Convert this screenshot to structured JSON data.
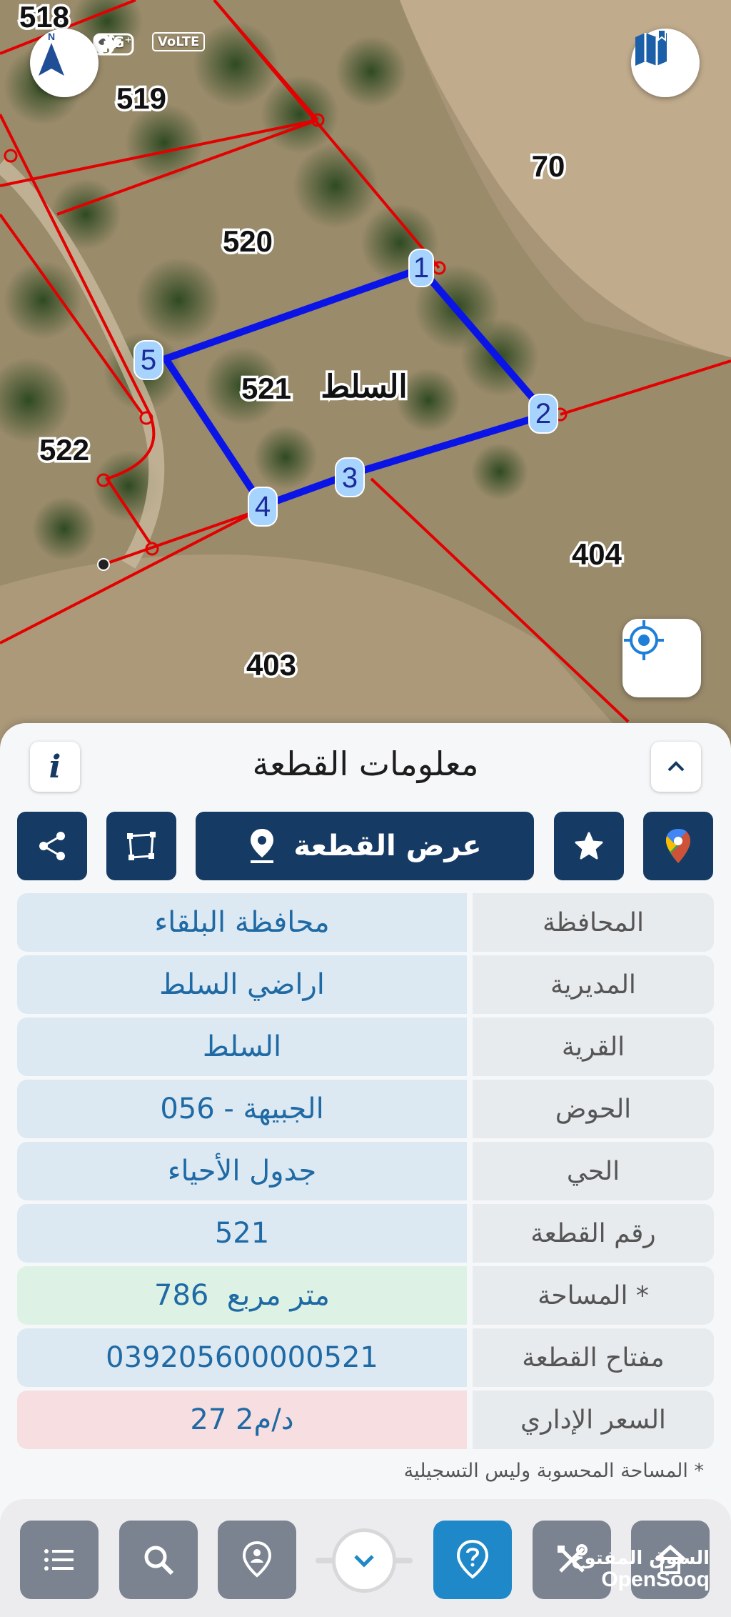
{
  "status_bar": {
    "network": "4G⁺",
    "volte": "VoLTE"
  },
  "map": {
    "parcels": {
      "p518": "518",
      "p519": "519",
      "p520": "520",
      "p521": "521",
      "p522": "522",
      "p70": "70",
      "p404": "404",
      "p403": "403"
    },
    "place_label": "السلط",
    "vertices": [
      "1",
      "2",
      "3",
      "4",
      "5"
    ],
    "compass_label": "N",
    "colors": {
      "boundary": "#e30000",
      "selected": "#0a14e6",
      "vertex": "#a7d3ff"
    }
  },
  "sheet": {
    "title": "معلومات القطعة",
    "info_label": "i",
    "show_parcel_label": "عرض القطعة",
    "rows": [
      {
        "label": "المحافظة",
        "value": "محافظة البلقاء"
      },
      {
        "label": "المديرية",
        "value": "اراضي السلط"
      },
      {
        "label": "القرية",
        "value": "السلط"
      },
      {
        "label": "الحوض",
        "value": "الجبيهة - 056"
      },
      {
        "label": "الحي",
        "value": "جدول الأحياء"
      },
      {
        "label": "رقم القطعة",
        "value": "521"
      },
      {
        "label": "المساحة *",
        "value": "786  متر مربع"
      },
      {
        "label": "مفتاح القطعة",
        "value": "039205600000521"
      },
      {
        "label": "السعر الإداري",
        "value": "27 د/م2"
      }
    ],
    "note": "* المساحة المحسوبة وليس التسجيلية"
  },
  "watermark": {
    "arabic": "السوق المفتوح",
    "latin": "OpenSooq"
  },
  "colors": {
    "navy": "#153a63",
    "accent": "#1e88c8",
    "nav_gray": "#7a838f"
  },
  "icons": [
    "navigation-arrow-icon",
    "map-book-icon",
    "gps-target-icon",
    "info-icon",
    "chevron-up-icon",
    "share-icon",
    "polygon-icon",
    "location-pin-icon",
    "star-icon",
    "google-maps-icon",
    "menu-list-icon",
    "search-icon",
    "person-pin-icon",
    "chevron-down-icon",
    "help-icon",
    "tools-icon",
    "home-icon"
  ]
}
